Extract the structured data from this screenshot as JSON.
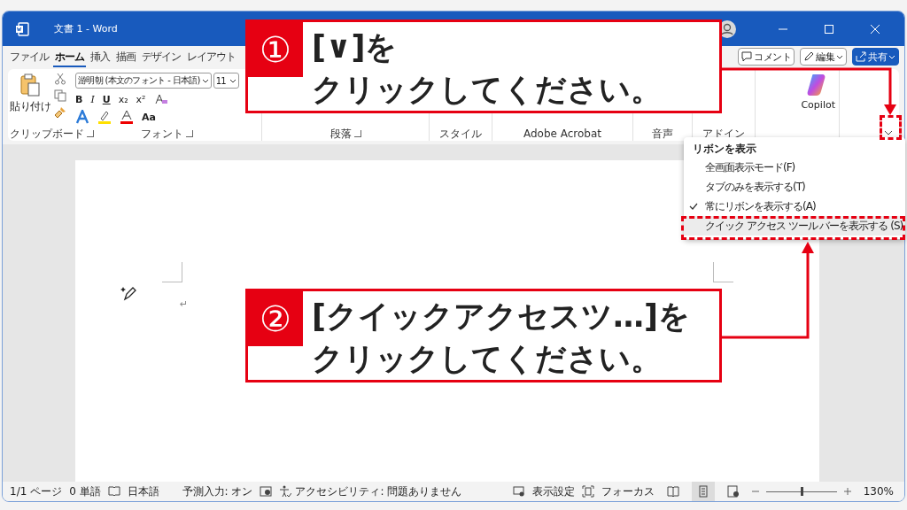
{
  "window": {
    "title": "文書 1 - Word"
  },
  "tabs": [
    {
      "label": "ファイル",
      "selected": false
    },
    {
      "label": "ホーム",
      "selected": true
    },
    {
      "label": "挿入",
      "selected": false
    },
    {
      "label": "描画",
      "selected": false
    },
    {
      "label": "デザイン",
      "selected": false
    },
    {
      "label": "レイアウト",
      "selected": false
    }
  ],
  "header_buttons": [
    {
      "kind": "comment",
      "label": "コメント"
    },
    {
      "kind": "edit",
      "label": "編集"
    },
    {
      "kind": "share",
      "label": "共有"
    }
  ],
  "ribbon": {
    "paste_label": "貼り付け",
    "font_name": "游明朝 (本文のフォント - 日本語)",
    "font_size": "11",
    "format_buttons": [
      "B",
      "I",
      "U",
      "x₂",
      "x²"
    ],
    "case_button": "Aa",
    "copilot": "Copilot",
    "groups": [
      {
        "label": "クリップボード",
        "launcher": true
      },
      {
        "label": "フォント",
        "launcher": true
      },
      {
        "label": "段落",
        "launcher": true
      },
      {
        "label": "スタイル",
        "launcher": false
      },
      {
        "label": "Adobe Acrobat",
        "launcher": false
      },
      {
        "label": "音声",
        "launcher": false
      },
      {
        "label": "アドイン",
        "launcher": false
      }
    ]
  },
  "menu": {
    "title": "リボンを表示",
    "items": [
      {
        "label": "全画面表示モード(F)",
        "checked": false,
        "selected": false
      },
      {
        "label": "タブのみを表示する(T)",
        "checked": false,
        "selected": false
      },
      {
        "label": "常にリボンを表示する(A)",
        "checked": true,
        "selected": false
      },
      {
        "label": "クイック アクセス ツール バーを表示する (S)",
        "checked": false,
        "selected": true
      }
    ]
  },
  "document": {
    "paragraph_mark": "↵"
  },
  "callouts": [
    {
      "number": "①",
      "lines": [
        "[∨]を",
        "クリックしてください。"
      ]
    },
    {
      "number": "②",
      "lines": [
        "[クイックアクセスツ…]を",
        "クリックしてください。"
      ]
    }
  ],
  "status_bar": {
    "page": "1/1 ページ",
    "words": "0 単語",
    "language": "日本語",
    "prediction": "予測入力: オン",
    "accessibility": "アクセシビリティ: 問題ありません",
    "display_settings": "表示設定",
    "focus": "フォーカス",
    "views": [
      {
        "kind": "read",
        "selected": false
      },
      {
        "kind": "print",
        "selected": true
      },
      {
        "kind": "web",
        "selected": false
      }
    ],
    "zoom": {
      "level": 0.5,
      "text": "130%"
    }
  }
}
